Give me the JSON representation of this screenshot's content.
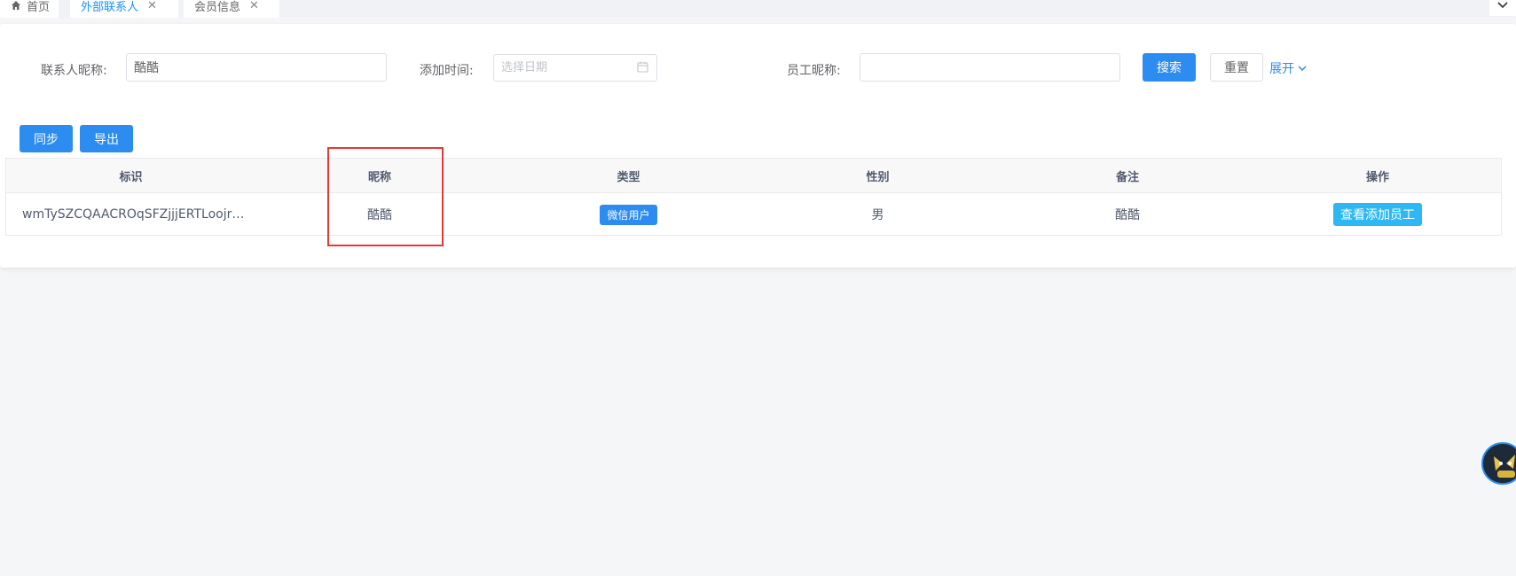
{
  "tabs": [
    {
      "label": "首页",
      "icon": "home-icon",
      "closable": false,
      "active": false
    },
    {
      "label": "外部联系人",
      "closable": true,
      "active": true
    },
    {
      "label": "会员信息",
      "closable": true,
      "active": false
    }
  ],
  "tab_close_glyph": "✕",
  "search": {
    "contact_nickname_label": "联系人昵称:",
    "contact_nickname_value": "酷酷",
    "add_time_label": "添加时间:",
    "add_time_placeholder": "选择日期",
    "employee_nickname_label": "员工昵称:",
    "employee_nickname_value": "",
    "search_button": "搜索",
    "reset_button": "重置",
    "expand_link": "展开"
  },
  "toolbar": {
    "sync_button": "同步",
    "export_button": "导出"
  },
  "table": {
    "columns": [
      "标识",
      "昵称",
      "类型",
      "性别",
      "备注",
      "操作"
    ],
    "rows": [
      {
        "id": "wmTySZCQAACROqSFZjjjERTLoojr…",
        "nickname": "酷酷",
        "type": "微信用户",
        "gender": "男",
        "remark": "酷酷",
        "action": "查看添加员工"
      }
    ]
  },
  "colors": {
    "primary": "#2d8cf0",
    "info": "#2db7f5",
    "highlight": "#e53935"
  }
}
